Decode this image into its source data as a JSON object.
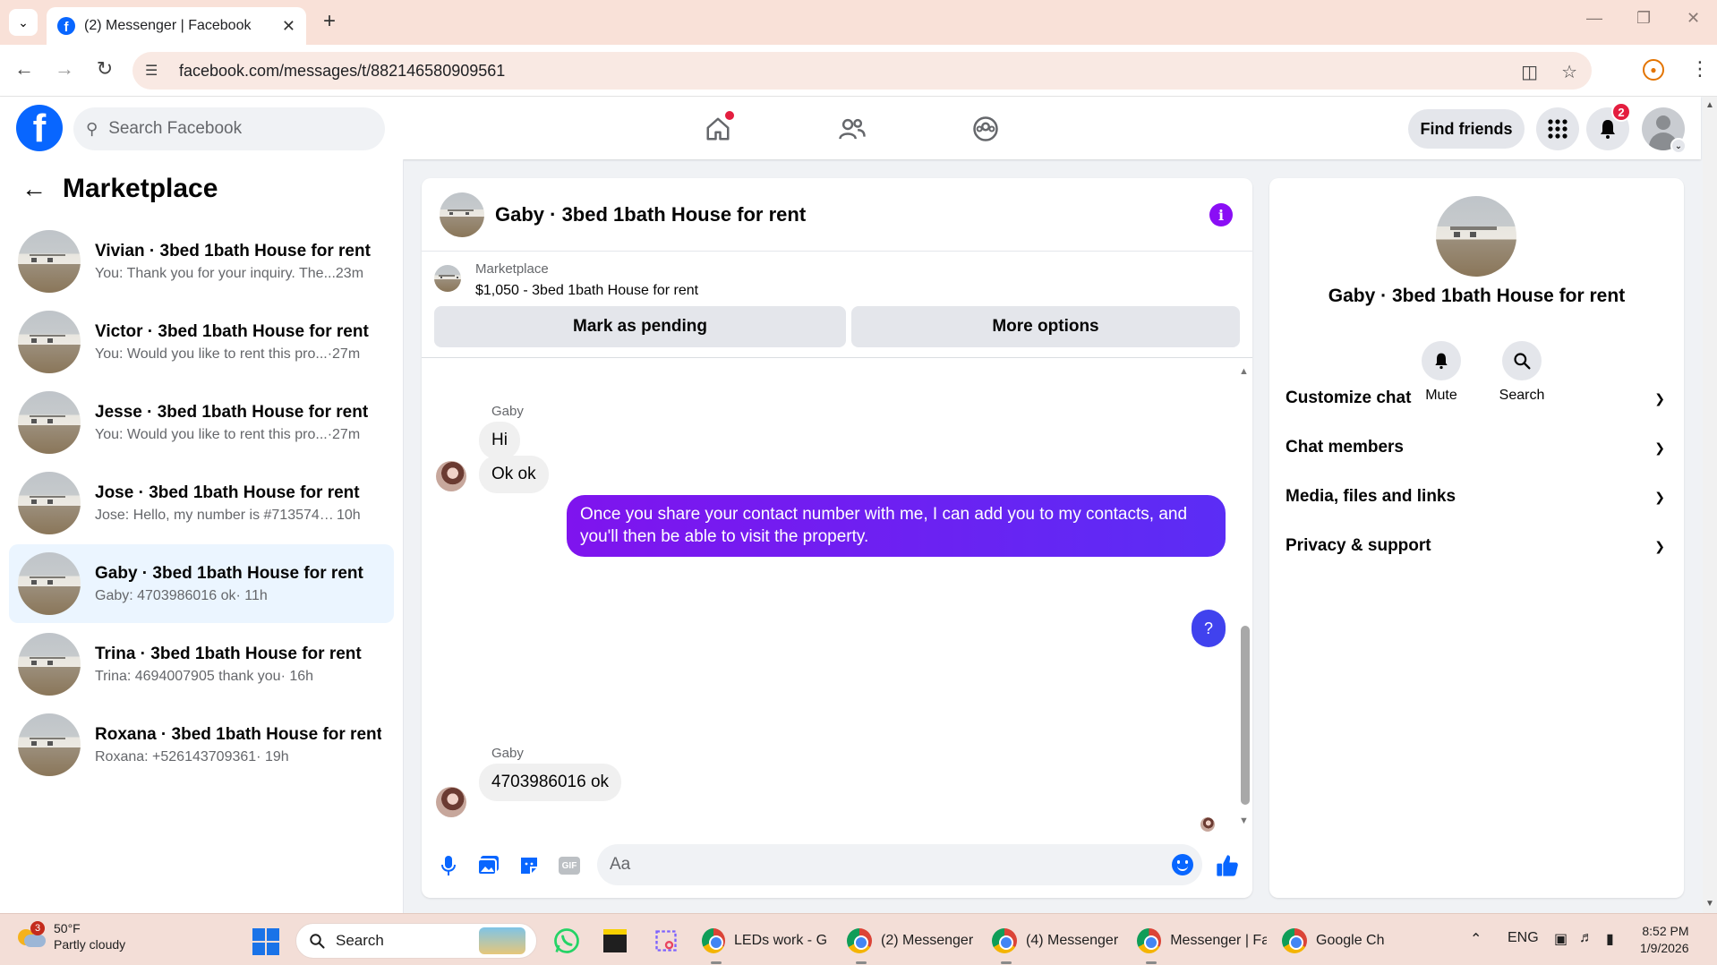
{
  "browser": {
    "tab_title": "(2) Messenger | Facebook",
    "url": "facebook.com/messages/t/882146580909561"
  },
  "fb": {
    "search_placeholder": "Search Facebook",
    "find_friends": "Find friends",
    "notification_count": "2",
    "brand_color": "#0866ff"
  },
  "sidebar": {
    "title": "Marketplace",
    "conversations": [
      {
        "name": "Vivian · 3bed 1bath House for rent",
        "preview": "You: Thank you for your inquiry. The...",
        "time": " 23m",
        "active": false
      },
      {
        "name": "Victor · 3bed 1bath House for rent",
        "preview": "You: Would you like to rent this pro...",
        "time": " ·27m",
        "active": false
      },
      {
        "name": "Jesse · 3bed 1bath House for rent",
        "preview": "You: Would you like to rent this pro...",
        "time": " ·27m",
        "active": false
      },
      {
        "name": "Jose · 3bed 1bath House for rent",
        "preview": "Jose: Hello, my number is #7135740...",
        "time": " 10h",
        "active": false
      },
      {
        "name": "Gaby · 3bed 1bath House for rent",
        "preview": "Gaby: 4703986016 ok",
        "time": " · 11h",
        "active": true
      },
      {
        "name": "Trina · 3bed 1bath House for rent",
        "preview": "Trina: 4694007905 thank you",
        "time": " · 16h",
        "active": false
      },
      {
        "name": "Roxana · 3bed 1bath House for rent",
        "preview": "Roxana: +526143709361",
        "time": " · 19h",
        "active": false
      }
    ]
  },
  "chat": {
    "title": "Gaby · 3bed 1bath House for rent",
    "listing_source": "Marketplace",
    "listing_name": "$1,050 - 3bed 1bath House for rent",
    "mark_pending": "Mark as pending",
    "more_options": "More options",
    "messages": {
      "sender1": "Gaby",
      "m1": "Hi",
      "m2": "Ok ok",
      "m3": "Once you share your contact number with me, I can add you to my contacts, and you'll then be able to visit the property.",
      "m4": "?",
      "sender2": "Gaby",
      "m5": "4703986016 ok"
    },
    "composer_placeholder": "Aa",
    "accent": "#7f14ee"
  },
  "details": {
    "name": "Gaby · 3bed 1bath House for rent",
    "mute": "Mute",
    "search": "Search",
    "sections": [
      "Customize chat",
      "Chat members",
      "Media, files and links",
      "Privacy & support"
    ]
  },
  "taskbar": {
    "weather_badge": "3",
    "temp": "50°F",
    "condition": "Partly cloudy",
    "search": "Search",
    "apps": [
      {
        "label": "LEDs work - Gc"
      },
      {
        "label": "(2) Messenger"
      },
      {
        "label": "(4) Messenger"
      },
      {
        "label": "Messenger | Fa"
      },
      {
        "label": "Google Ch"
      }
    ],
    "lang": "ENG",
    "time": "8:52 PM",
    "date": "1/9/2026"
  }
}
